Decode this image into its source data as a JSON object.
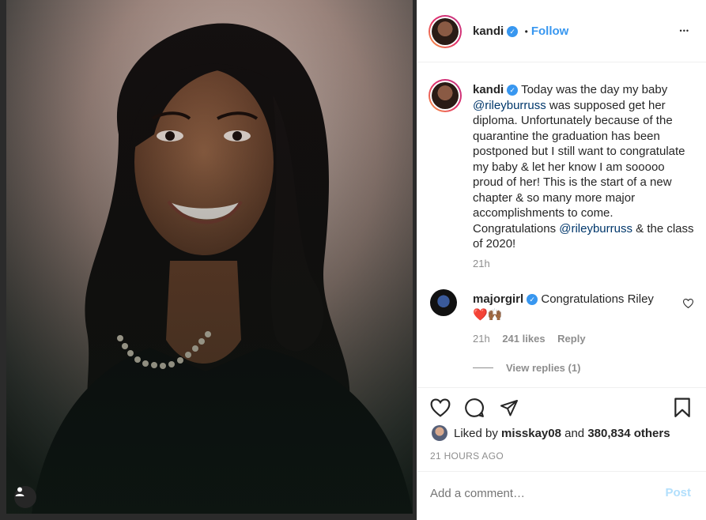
{
  "post": {
    "author": "kandi",
    "verified_mark": "✓",
    "dot": "•",
    "follow_label": "Follow",
    "more_label": "•••"
  },
  "caption": {
    "author": "kandi",
    "text_before": "Today was the day my baby ",
    "mention1": "@rileyburruss",
    "text_middle": " was supposed get her diploma. Unfortunately because of the quarantine the graduation has been postponed but I still want to congratulate my baby & let her know I am sooooo proud of her! This is the start of a new chapter & so many more major accomplishments to come. Congratulations ",
    "mention2": "@rileyburruss",
    "text_after": " & the class of 2020!",
    "time": "21h"
  },
  "comment": {
    "author": "majorgirl",
    "text": "Congratulations Riley",
    "emoji": "❤️🙌🏾",
    "time": "21h",
    "likes": "241 likes",
    "reply_label": "Reply",
    "view_replies": "View replies (1)"
  },
  "likes": {
    "prefix": "Liked by ",
    "user": "misskay08",
    "middle": " and ",
    "count": "380,834 others"
  },
  "timestamp": "21 HOURS AGO",
  "comment_box": {
    "placeholder": "Add a comment…",
    "post_label": "Post"
  },
  "icons": {
    "like": "heart-icon",
    "comment": "comment-icon",
    "share": "share-icon",
    "save": "bookmark-icon",
    "comment_like": "heart-icon",
    "user_tag": "user-tag-icon"
  },
  "colors": {
    "accent": "#3897f0",
    "mention": "#00376b",
    "muted": "#8e8e8e",
    "post_disabled": "#b2dffc"
  }
}
